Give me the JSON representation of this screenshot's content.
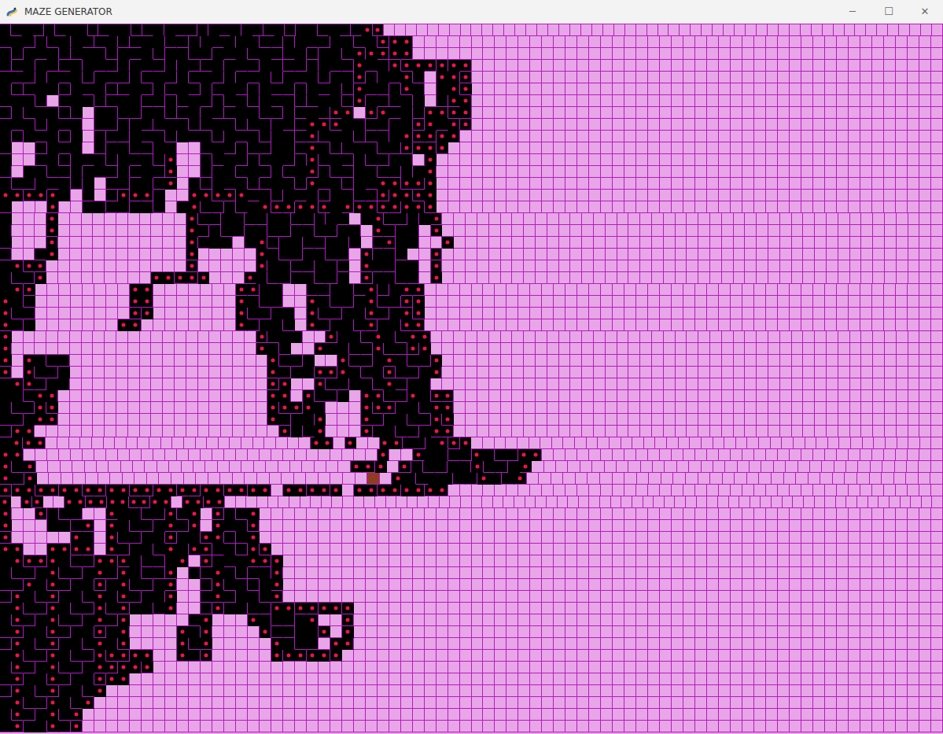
{
  "window": {
    "title": "MAZE GENERATOR",
    "controls": [
      "─",
      "☐",
      "✕"
    ]
  },
  "maze": {
    "rows": [
      "bcadbcabdcabdcbacdbacbadcbdabcadcBD...................................................",
      "cadbcbadcbdcabcdbacbabcdbacdabcbDAB.............................................",
      "bdacbdcabdacbdabcdacbcadcbdabcBADCD.............................................",
      "dcbadcbacdbacdbadcbacdabcdbacdAcbBCADBAD........................................",
      "acdbacbdacdbcadbcadbacbdacbdabDbacBd.ABD........................................",
      "bdcabdacbdcadbcadbcadbacdbacbdAcdbCb.aBC........................................",
      "cabd.cabdcabcdbcadbcbdacbdcabdBadcba.dCB........................................",
      "dbcabdc.abcdabdcbadcabcdbcadCB.DAcbdABCD........................................",
      "acbdacb.cdbadcabdcabdcbadcABCabcdabDAcBD........................................",
      "bdacbda.bcdacbdacbdacbdabcDcabdcbaBCDAB.........................................",
      "c..dacb.dabcdab..cadbcdabcAbdcabcdDABC..........................................",
      "a..cbdacbdacbdB..bcadbcadbBcadbcdab.A...........................................",
      "d.abcdbacdbcadC..dabcadbcaDbcdabcdbaB...........................................",
      "bcdacbda.cdabcA.bdacbdcabdAcbdacABCDA...........................................",
      "ABCDAb.c.dBCDa..ABCDAcbdacbdabcdDABCA...........................................",
      "c...D..abcdabc.aBcdbcaBCDABCaDABCDABC...........................................",
      "a...A...........Bcdabcdabcdbac aBcdbaD...........................................",
      "b...C...........Adbcdabcdabcdab Cdab.C...........................................",
      "c...B...........Bcab cBdabcdabc cDab..A..........................................",
      "d..cA...........C.....Abcdabcd Babc..D...........................................",
      "aBCD............D.....Babcdabc Ccdab.B...........................................",
      "bcdA.........ABCDA...Cbcdabcda Dabcd.C...........................................",
      "aBC........AB.......CDab..cdabcBdaCD............................................",
      "Abc........CD.......Abcd..AbcdaBcdDA............................................",
      "Bcd........DA.......Bcdab.BcdabCdaBC............................................",
      "Cda.......AB........Cdabc.CdabcDabCD............................................",
      "A.....................Dcab..DabcAbcAB............................................",
      "B.....................Abc..AabcdBcdDA............................................",
      "C.Abcd.................Bcda..BcdaCbcdA...........................................",
      "D.Bcda.................CdabCDAbcbDcdaB...........................................",
      "aBCdab.................DA..BcdabcAdab............................................",
      "abcAB..................AB.Bcda.ABcdAbCD..........................................",
      "bcdBC..................BCDAb...BCDabcAB..........................................",
      "cdaCD..................CdabA...CdabcdBC..........................................",
      "dAB.....................DbcB...DabcdaCD..........................................",
      "aBCD.......................AB.C..ABcdaBDA.........................................",
      "AB..............................B..CabcdAbcdAB..................................",
      "BcD..........................CDA.DbcdabBcdaC..................................",
      "CdA...........................@.AbcabcdAbcD..................................",
      "DABCDABCDABCDABCDABCDAB.ABCDA.ABCDABCD..........................................",
      "A.BC..ABCDABCDAB.ABCD...................................................................",
      "B..Dbcd..CabcdBcA.DbcA..........................................................",
      "C...abcD.AbcdaCdB.AcbD..........................................................",
      "D.....Ab.BcdabDabCBdcA..........................................................",
      "AB..ABCD.CdabcAbCDcbdBC.........................................................",
      "aBCDAbcdABCbcdaB.DacaCDA........................................................",
      "bcdaBcdaCdAbcdC.bcAbdcbB........................................................",
      "cdAbCdabDaBcdaD..dBcbdaC........................................................",
      "dAbcDabcAbCdabA..cCdabcD........................................................",
      "aBcdAbcdBcDabcB..dDabcdABCDABC..................................................",
      "bCdaBcdaCdA.....cA...AbcdaB..D..................................................",
      "cDabCdabDaB....AbB....BcdabC.A..................................................",
      "dAbcDabcAbC....BcC.....Abcd.AB..................................................",
      "aBcdAbcdBCDAB..CdD.....BCDABC...................................................",
      "bCdaBcdaCDABC...................................................................",
      "cDabCdabDAB.....................................................................",
      "dAbcDabcA.......................................................................",
      "aBcdAbcB........................................................................",
      "bCdaBcC.........................................................................",
      "cDabCdD........................................................................."
    ]
  }
}
